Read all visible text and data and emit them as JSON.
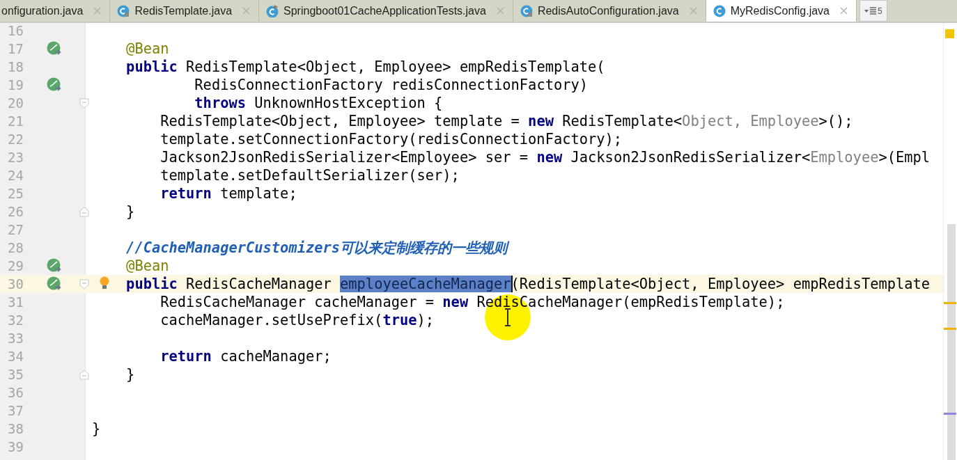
{
  "tabs": [
    {
      "label": "onfiguration.java",
      "kind": "plain",
      "selected": false
    },
    {
      "label": "RedisTemplate.java",
      "kind": "locked-class",
      "selected": false
    },
    {
      "label": "Springboot01CacheApplicationTests.java",
      "kind": "test-class",
      "selected": false
    },
    {
      "label": "RedisAutoConfiguration.java",
      "kind": "locked-class",
      "selected": false
    },
    {
      "label": "MyRedisConfig.java",
      "kind": "class",
      "selected": true
    }
  ],
  "tab_overflow": {
    "count": "5"
  },
  "editor": {
    "lines": [
      {
        "number": "16"
      },
      {
        "number": "17",
        "bean_marker": true,
        "segments": [
          {
            "kind": "annotation",
            "text": "    @Bean"
          }
        ]
      },
      {
        "number": "18",
        "segments": [
          {
            "kind": "keyword",
            "text": "    public"
          },
          {
            "kind": "plain",
            "text": " RedisTemplate<Object, Employee> empRedisTemplate("
          }
        ]
      },
      {
        "number": "19",
        "bean_marker": true,
        "segments": [
          {
            "kind": "plain",
            "text": "            RedisConnectionFactory redisConnectionFactory)"
          }
        ]
      },
      {
        "number": "20",
        "fold_start": true,
        "segments": [
          {
            "kind": "keyword",
            "text": "            throws"
          },
          {
            "kind": "plain",
            "text": " UnknownHostException {"
          }
        ]
      },
      {
        "number": "21",
        "segments": [
          {
            "kind": "plain",
            "text": "        RedisTemplate<Object, Employee> template = "
          },
          {
            "kind": "keyword",
            "text": "new"
          },
          {
            "kind": "plain",
            "text": " RedisTemplate<"
          },
          {
            "kind": "inferred",
            "text": "Object, Employee"
          },
          {
            "kind": "plain",
            "text": ">();"
          }
        ]
      },
      {
        "number": "22",
        "segments": [
          {
            "kind": "plain",
            "text": "        template.setConnectionFactory(redisConnectionFactory);"
          }
        ]
      },
      {
        "number": "23",
        "segments": [
          {
            "kind": "plain",
            "text": "        Jackson2JsonRedisSerializer<Employee> ser = "
          },
          {
            "kind": "keyword",
            "text": "new"
          },
          {
            "kind": "plain",
            "text": " Jackson2JsonRedisSerializer<"
          },
          {
            "kind": "inferred",
            "text": "Employee"
          },
          {
            "kind": "plain",
            "text": ">(Empl"
          }
        ]
      },
      {
        "number": "24",
        "segments": [
          {
            "kind": "plain",
            "text": "        template.setDefaultSerializer(ser);"
          }
        ]
      },
      {
        "number": "25",
        "segments": [
          {
            "kind": "keyword",
            "text": "        return"
          },
          {
            "kind": "plain",
            "text": " template;"
          }
        ]
      },
      {
        "number": "26",
        "fold_end": true,
        "segments": [
          {
            "kind": "plain",
            "text": "    }"
          }
        ]
      },
      {
        "number": "27"
      },
      {
        "number": "28",
        "segments": [
          {
            "kind": "comment",
            "text": "    //CacheManagerCustomizers可以来定制缓存的一些规则"
          }
        ]
      },
      {
        "number": "29",
        "bean_marker": true,
        "segments": [
          {
            "kind": "annotation",
            "text": "    @Bean"
          }
        ]
      },
      {
        "number": "30",
        "current": true,
        "bean_marker": true,
        "fold_start": true,
        "bulb": true,
        "segments": [
          {
            "kind": "keyword",
            "text": "    public"
          },
          {
            "kind": "plain",
            "text": " RedisCacheManager "
          },
          {
            "kind": "selected",
            "text": "employeeCacheManager"
          },
          {
            "kind": "plain",
            "text": "(RedisTemplate<Object, Employee> empRedisTemplate"
          }
        ]
      },
      {
        "number": "31",
        "segments": [
          {
            "kind": "plain",
            "text": "        RedisCacheManager cacheManager = "
          },
          {
            "kind": "keyword",
            "text": "new"
          },
          {
            "kind": "plain",
            "text": " RedisCacheManager(empRedisTemplate);"
          }
        ]
      },
      {
        "number": "32",
        "segments": [
          {
            "kind": "plain",
            "text": "        cacheManager.setUsePrefix("
          },
          {
            "kind": "keyword",
            "text": "true"
          },
          {
            "kind": "plain",
            "text": ");"
          }
        ]
      },
      {
        "number": "33"
      },
      {
        "number": "34",
        "segments": [
          {
            "kind": "keyword",
            "text": "        return"
          },
          {
            "kind": "plain",
            "text": " cacheManager;"
          }
        ]
      },
      {
        "number": "35",
        "fold_end": true,
        "segments": [
          {
            "kind": "plain",
            "text": "    }"
          }
        ]
      },
      {
        "number": "36"
      },
      {
        "number": "37"
      },
      {
        "number": "38",
        "segments": [
          {
            "kind": "plain",
            "text": "}"
          }
        ]
      },
      {
        "number": "39"
      }
    ],
    "stripe_marks": [
      {
        "color": "#f0b400"
      },
      {
        "color": "#f0b400"
      },
      {
        "color": "#8c86e0"
      }
    ]
  }
}
